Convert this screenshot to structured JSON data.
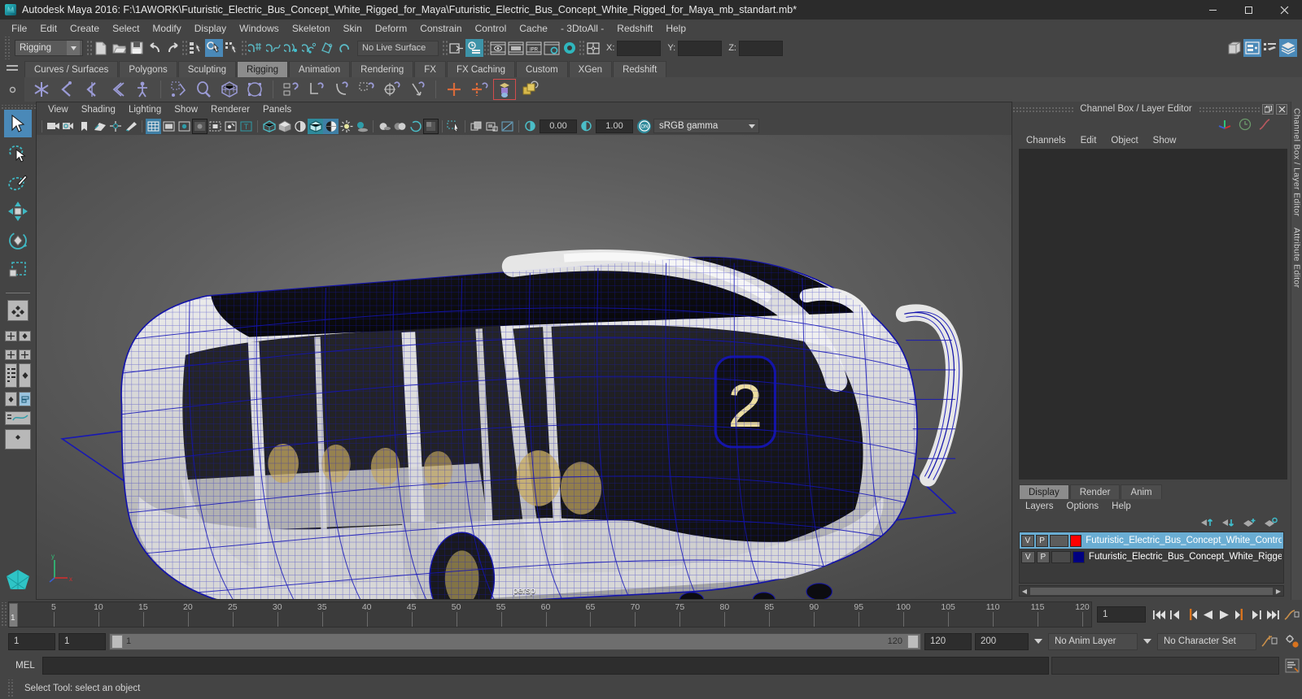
{
  "window": {
    "title": "Autodesk Maya 2016: F:\\1AWORK\\Futuristic_Electric_Bus_Concept_White_Rigged_for_Maya\\Futuristic_Electric_Bus_Concept_White_Rigged_for_Maya_mb_standart.mb*",
    "logo_name": "maya-logo-icon",
    "minimize": "–",
    "maximize": "❐",
    "close": "✕"
  },
  "menubar": {
    "items": [
      "File",
      "Edit",
      "Create",
      "Select",
      "Modify",
      "Display",
      "Windows",
      "Skeleton",
      "Skin",
      "Deform",
      "Constrain",
      "Control",
      "Cache",
      "- 3DtoAll -",
      "Redshift",
      "Help"
    ]
  },
  "statusbar": {
    "menuset": "Rigging",
    "live_surface": "No Live Surface",
    "x_label": "X:",
    "y_label": "Y:",
    "z_label": "Z:",
    "x_value": "",
    "y_value": "",
    "z_value": ""
  },
  "shelf": {
    "tabs": [
      "Curves / Surfaces",
      "Polygons",
      "Sculpting",
      "Rigging",
      "Animation",
      "Rendering",
      "FX",
      "FX Caching",
      "Custom",
      "XGen",
      "Redshift"
    ],
    "active_tab": "Rigging"
  },
  "viewport": {
    "menus": [
      "View",
      "Shading",
      "Lighting",
      "Show",
      "Renderer",
      "Panels"
    ],
    "exposure_value": "0.00",
    "gamma_value": "1.00",
    "color_profile": "sRGB gamma",
    "camera_label": "persp"
  },
  "right_panel": {
    "title": "Channel Box / Layer Editor",
    "channel_menus": [
      "Channels",
      "Edit",
      "Object",
      "Show"
    ],
    "layer_tabs": [
      "Display",
      "Render",
      "Anim"
    ],
    "active_layer_tab": "Display",
    "layer_menus": [
      "Layers",
      "Options",
      "Help"
    ],
    "layers": [
      {
        "v": "V",
        "p": "P",
        "third": "",
        "color": "#ff0000",
        "name": "Futuristic_Electric_Bus_Concept_White_Controllers",
        "selected": true
      },
      {
        "v": "V",
        "p": "P",
        "third": "",
        "color": "#000080",
        "name": "Futuristic_Electric_Bus_Concept_White_Rigged",
        "selected": false
      }
    ],
    "side_tabs": [
      "Channel Box / Layer Editor",
      "Attribute Editor"
    ]
  },
  "timeline": {
    "ticks": [
      5,
      10,
      15,
      20,
      25,
      30,
      35,
      40,
      45,
      50,
      55,
      60,
      65,
      70,
      75,
      80,
      85,
      90,
      95,
      100,
      105,
      110,
      115,
      120
    ],
    "current_frame": "1",
    "current_frame_field": "1",
    "playback_buttons": [
      "go-to-start",
      "step-back-key",
      "step-back-frame",
      "play-backwards",
      "play-forwards",
      "step-forward-frame",
      "step-forward-key",
      "go-to-end"
    ]
  },
  "range": {
    "start_field": "1",
    "anim_start_field": "1",
    "slider_min_label": "1",
    "slider_max_label": "120",
    "anim_end_field": "120",
    "end_field": "200",
    "anim_layer": "No Anim Layer",
    "character_set": "No Character Set"
  },
  "mel": {
    "label": "MEL",
    "command_value": "",
    "result_value": ""
  },
  "status": {
    "help_text": "Select Tool: select an object"
  },
  "toolbox": {
    "items": [
      {
        "name": "select-tool",
        "label": "Select Tool",
        "selected": true
      },
      {
        "name": "lasso-select-tool",
        "label": "Lasso Select Tool",
        "selected": false
      },
      {
        "name": "paint-select-tool",
        "label": "Paint Select Tool",
        "selected": false
      },
      {
        "name": "move-tool",
        "label": "Move Tool",
        "selected": false
      },
      {
        "name": "rotate-tool",
        "label": "Rotate Tool",
        "selected": false
      },
      {
        "name": "scale-tool",
        "label": "Scale Tool",
        "selected": false
      }
    ]
  },
  "colors": {
    "accent_blue": "#4a89b8",
    "accent_teal": "#2f8a9b",
    "layer_red": "#ff0000",
    "layer_navy": "#000080",
    "selected_row": "#6aadd3",
    "panel_bg": "#444444",
    "field_bg": "#2d2d2d"
  }
}
